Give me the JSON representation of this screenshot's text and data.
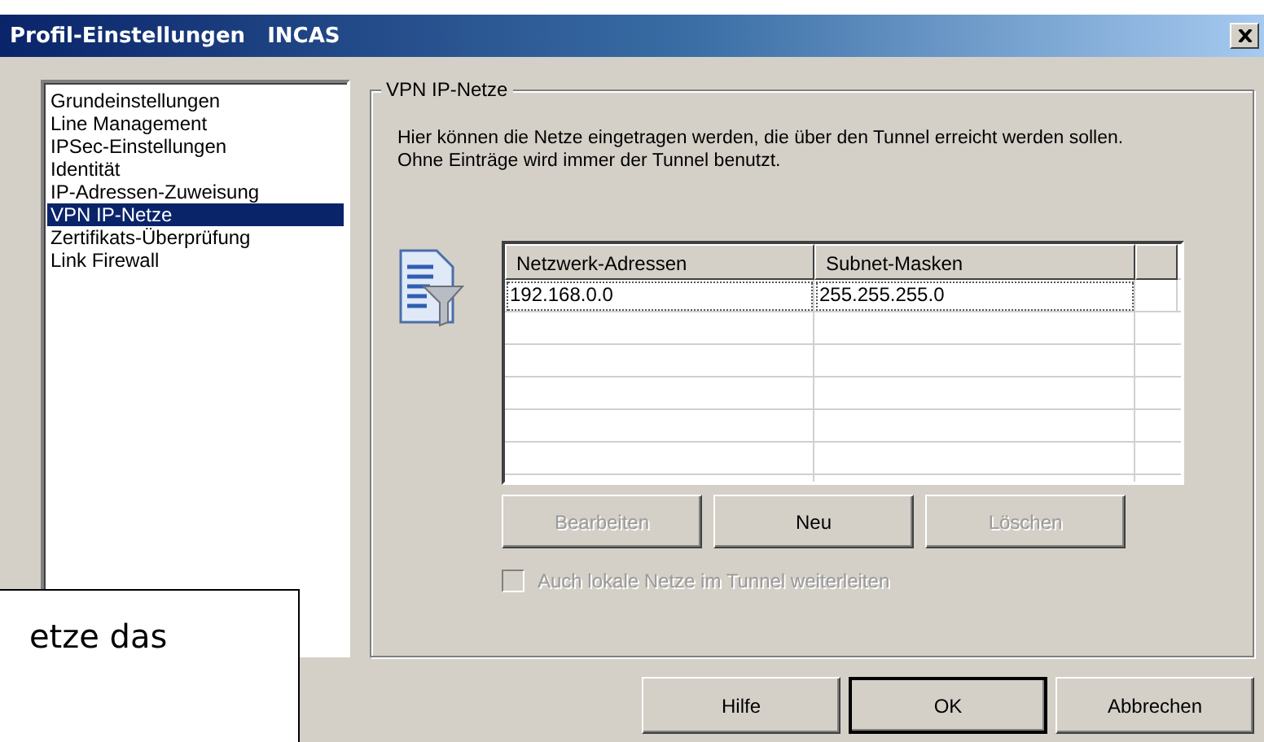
{
  "window": {
    "title": "Profil-Einstellungen   INCAS"
  },
  "sidebar": {
    "items": [
      {
        "label": "Grundeinstellungen",
        "selected": false
      },
      {
        "label": "Line Management",
        "selected": false
      },
      {
        "label": "IPSec-Einstellungen",
        "selected": false
      },
      {
        "label": "Identität",
        "selected": false
      },
      {
        "label": "IP-Adressen-Zuweisung",
        "selected": false
      },
      {
        "label": "VPN IP-Netze",
        "selected": true
      },
      {
        "label": "Zertifikats-Überprüfung",
        "selected": false
      },
      {
        "label": "Link Firewall",
        "selected": false
      }
    ]
  },
  "group": {
    "title": "VPN IP-Netze",
    "description": "Hier können die Netze eingetragen werden, die über den Tunnel erreicht werden sollen. Ohne Einträge wird immer der Tunnel benutzt."
  },
  "table": {
    "columns": [
      "Netzwerk-Adressen",
      "Subnet-Masken"
    ],
    "rows": [
      {
        "cells": [
          "192.168.0.0",
          "255.255.255.0"
        ],
        "selected": true
      }
    ]
  },
  "table_buttons": [
    {
      "label": "Bearbeiten",
      "disabled": true
    },
    {
      "label": "Neu",
      "disabled": false
    },
    {
      "label": "Löschen",
      "disabled": true
    }
  ],
  "checkbox": {
    "label": "Auch lokale Netze im Tunnel weiterleiten",
    "checked": false,
    "disabled": true
  },
  "dialog_buttons": [
    {
      "label": "Hilfe",
      "default": false
    },
    {
      "label": "OK",
      "default": true
    },
    {
      "label": "Abbrechen",
      "default": false
    }
  ],
  "callout": {
    "text": "etze das"
  }
}
